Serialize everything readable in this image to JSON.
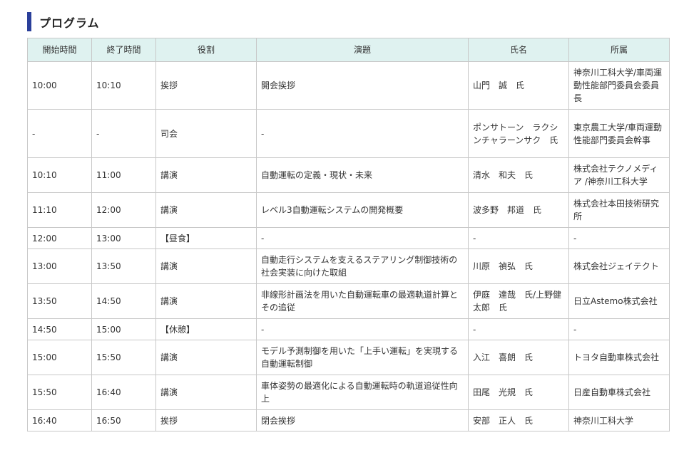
{
  "section": {
    "title": "プログラム"
  },
  "program": {
    "headers": [
      "開始時間",
      "終了時間",
      "役割",
      "演題",
      "氏名",
      "所属"
    ],
    "rows": [
      [
        "10:00",
        "10:10",
        "挨拶",
        "開会挨拶",
        "山門　誠　氏",
        "神奈川工科大学/車両運動性能部門委員会委員長"
      ],
      [
        "-",
        "-",
        "司会",
        "-",
        "ポンサトーン　ラクシンチャラーンサク　氏",
        "東京農工大学/車両運動性能部門委員会幹事"
      ],
      [
        "10:10",
        "11:00",
        "講演",
        "自動運転の定義・現状・未来",
        "清水　和夫　氏",
        "株式会社テクノメディア /神奈川工科大学"
      ],
      [
        "11:10",
        "12:00",
        "講演",
        "レベル3自動運転システムの開発概要",
        "波多野　邦道　氏",
        "株式会社本田技術研究所"
      ],
      [
        "12:00",
        "13:00",
        "【昼食】",
        "-",
        "-",
        "-"
      ],
      [
        "13:00",
        "13:50",
        "講演",
        "自動走行システムを支えるステアリング制御技術の社会実装に向けた取組",
        "川原　禎弘　氏",
        "株式会社ジェイテクト"
      ],
      [
        "13:50",
        "14:50",
        "講演",
        "非線形計画法を用いた自動運転車の最適軌道計算とその追従",
        "伊庭　達哉　氏/上野健太郎　氏",
        "日立Astemo株式会社"
      ],
      [
        "14:50",
        "15:00",
        "【休憩】",
        "-",
        "-",
        "-"
      ],
      [
        "15:00",
        "15:50",
        "講演",
        "モデル予測制御を用いた「上手い運転」を実現する自動運転制御",
        "入江　喜朗　氏",
        "トヨタ自動車株式会社"
      ],
      [
        "15:50",
        "16:40",
        "講演",
        "車体姿勢の最適化による自動運転時の軌道追従性向上",
        "田尾　光規　氏",
        "日産自動車株式会社"
      ],
      [
        "16:40",
        "16:50",
        "挨拶",
        "閉会挨拶",
        "安部　正人　氏",
        "神奈川工科大学"
      ]
    ]
  }
}
